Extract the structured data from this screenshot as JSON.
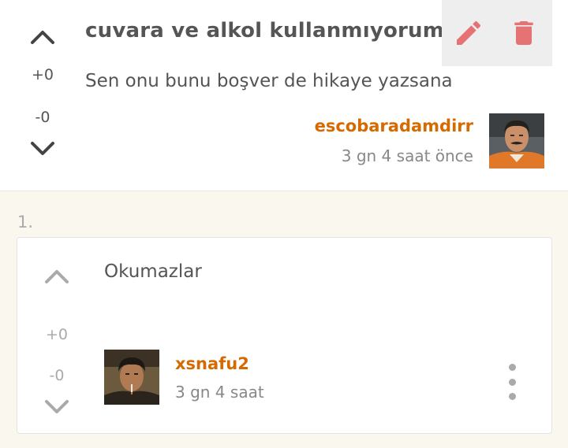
{
  "post": {
    "title": "cuvara ve alkol kullanmıyorum",
    "body": "Sen onu bunu boşver de hikaye yazsana",
    "upvotes": "+0",
    "downvotes": "-0",
    "author": "escobaradamdirr",
    "time": "3 gn 4 saat  önce"
  },
  "actions": {
    "edit_icon": "pencil-icon",
    "delete_icon": "trash-icon",
    "icon_color": "#e57373"
  },
  "comments": [
    {
      "index": "1.",
      "text": "Okumazlar",
      "upvotes": "+0",
      "downvotes": "-0",
      "author": "xsnafu2",
      "time": "3 gn 4 saat"
    }
  ],
  "colors": {
    "accent": "#d56b00",
    "background": "#faf7ef"
  }
}
